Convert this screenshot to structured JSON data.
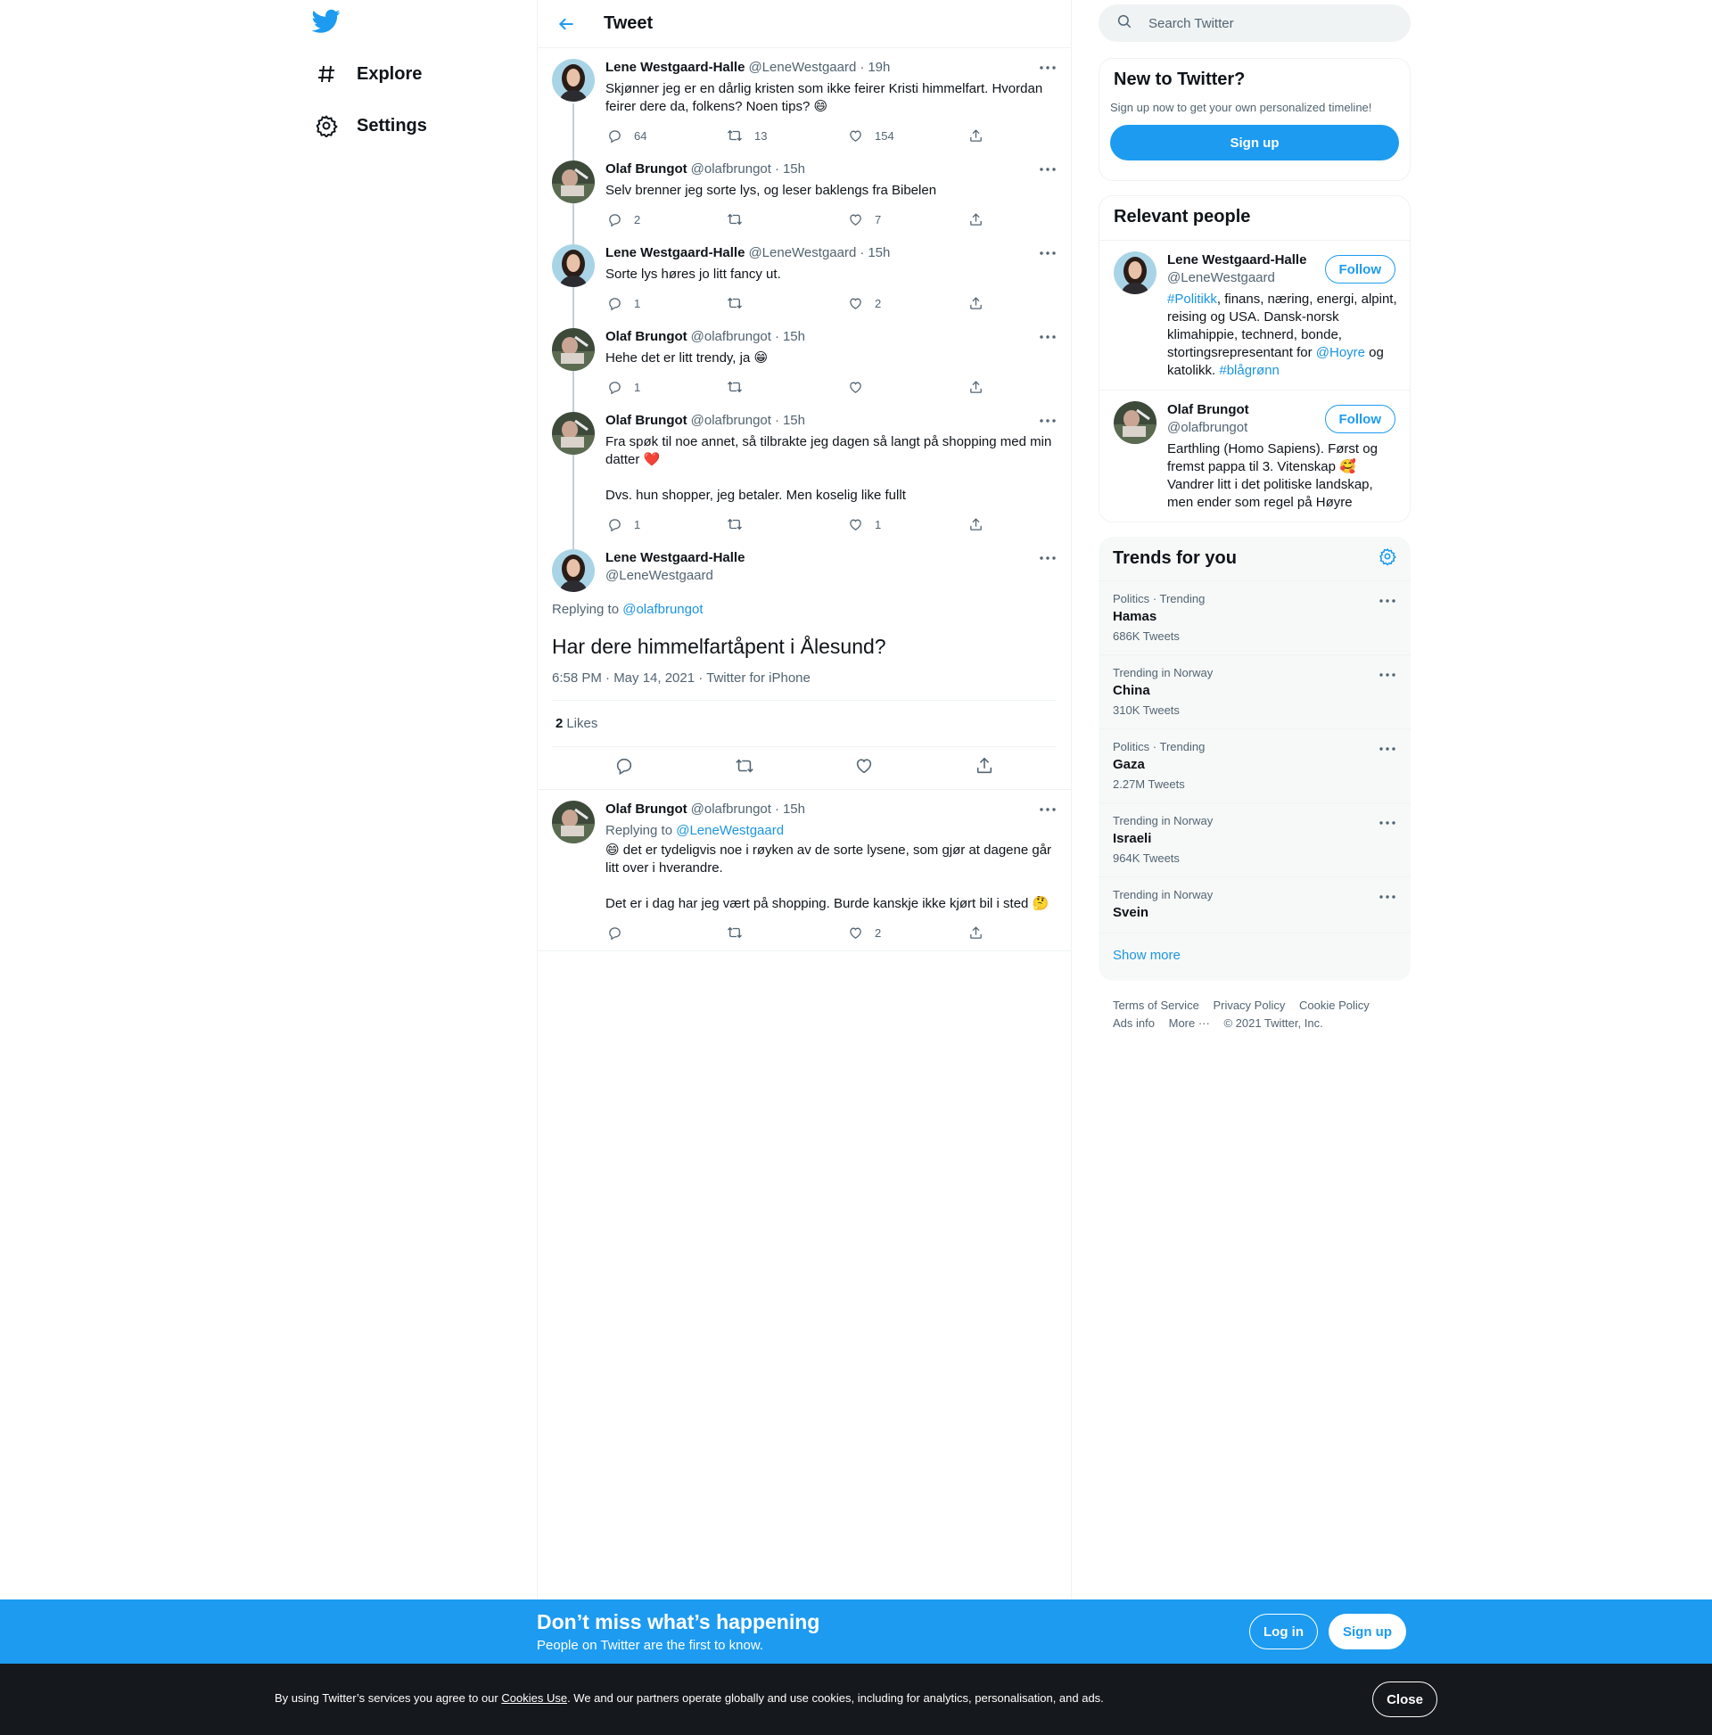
{
  "nav": {
    "items": [
      {
        "label": "Explore",
        "icon": "hashtag-icon"
      },
      {
        "label": "Settings",
        "icon": "gear-icon"
      }
    ]
  },
  "header": {
    "title": "Tweet"
  },
  "thread": [
    {
      "name": "Lene Westgaard-Halle",
      "handle": "@LeneWestgaard",
      "time": "19h",
      "text": "Skjønner jeg er en dårlig kristen som ikke feirer Kristi himmelfart. Hvordan feirer dere da, folkens? Noen tips? 😄",
      "replies": "64",
      "retweets": "13",
      "likes": "154"
    },
    {
      "name": "Olaf Brungot",
      "handle": "@olafbrungot",
      "time": "15h",
      "text": "Selv brenner jeg sorte lys, og leser baklengs fra Bibelen",
      "replies": "2",
      "retweets": "",
      "likes": "7"
    },
    {
      "name": "Lene Westgaard-Halle",
      "handle": "@LeneWestgaard",
      "time": "15h",
      "text": "Sorte lys høres jo litt fancy ut.",
      "replies": "1",
      "retweets": "",
      "likes": "2"
    },
    {
      "name": "Olaf Brungot",
      "handle": "@olafbrungot",
      "time": "15h",
      "text": "Hehe det er litt trendy, ja 😁",
      "replies": "1",
      "retweets": "",
      "likes": ""
    },
    {
      "name": "Olaf Brungot",
      "handle": "@olafbrungot",
      "time": "15h",
      "text": "Fra spøk til noe annet, så tilbrakte jeg dagen så langt på shopping med min datter ❤️",
      "text2": "Dvs. hun shopper, jeg betaler. Men koselig like fullt",
      "replies": "1",
      "retweets": "",
      "likes": "1"
    }
  ],
  "main_tweet": {
    "name": "Lene Westgaard-Halle",
    "handle": "@LeneWestgaard",
    "replying_label": "Replying to",
    "replying_to": "@olafbrungot",
    "text": "Har dere himmelfartåpent i Ålesund?",
    "meta": "6:58 PM · May 14, 2021 · Twitter for iPhone",
    "likes_count": "2",
    "likes_label": "Likes"
  },
  "reply": {
    "name": "Olaf Brungot",
    "handle": "@olafbrungot",
    "time": "15h",
    "replying_label": "Replying to",
    "replying_to": "@LeneWestgaard",
    "text": "😄 det er tydeligvis noe i røyken av de sorte lysene, som gjør at dagene går litt over i hverandre.",
    "text2": "Det er i dag har jeg vært på shopping. Burde kanskje ikke kjørt bil i sted 🤔",
    "replies": "",
    "retweets": "",
    "likes": "2"
  },
  "search": {
    "placeholder": "Search Twitter"
  },
  "new_to_twitter": {
    "title": "New to Twitter?",
    "subtitle": "Sign up now to get your own personalized timeline!",
    "button": "Sign up"
  },
  "relevant": {
    "title": "Relevant people",
    "people": [
      {
        "name": "Lene Westgaard-Halle",
        "handle": "@LeneWestgaard",
        "follow": "Follow",
        "bio_parts": [
          "#Politikk",
          ", finans, næring, energi, alpint, reising og USA. Dansk-norsk klimahippie, technerd, bonde, stortingsrepresentant for ",
          "@Hoyre",
          " og katolikk. ",
          "#blågrønn"
        ]
      },
      {
        "name": "Olaf Brungot",
        "handle": "@olafbrungot",
        "follow": "Follow",
        "bio": "Earthling (Homo Sapiens). Først og fremst pappa til 3. Vitenskap 🥰 Vandrer litt i det politiske landskap, men ender som regel på Høyre"
      }
    ]
  },
  "trends": {
    "title": "Trends for you",
    "items": [
      {
        "context": "Politics · Trending",
        "name": "Hamas",
        "count": "686K Tweets"
      },
      {
        "context": "Trending in Norway",
        "name": "China",
        "count": "310K Tweets"
      },
      {
        "context": "Politics · Trending",
        "name": "Gaza",
        "count": "2.27M Tweets"
      },
      {
        "context": "Trending in Norway",
        "name": "Israeli",
        "count": "964K Tweets"
      },
      {
        "context": "Trending in Norway",
        "name": "Svein",
        "count": ""
      }
    ],
    "show_more": "Show more"
  },
  "footer": {
    "links": [
      "Terms of Service",
      "Privacy Policy",
      "Cookie Policy",
      "Ads info",
      "More ···"
    ],
    "copyright": "© 2021 Twitter, Inc."
  },
  "banner": {
    "title": "Don’t miss what’s happening",
    "subtitle": "People on Twitter are the first to know.",
    "login": "Log in",
    "signup": "Sign up"
  },
  "cookies": {
    "text_before": "By using Twitter’s services you agree to our ",
    "link": "Cookies Use",
    "text_after": ". We and our partners operate globally and use cookies, including for analytics, personalisation, and ads.",
    "close": "Close"
  },
  "colors": {
    "accent": "#1d9bf0",
    "link": "#1b95e0",
    "muted": "#536471",
    "cookie_bg": "#15181c"
  }
}
